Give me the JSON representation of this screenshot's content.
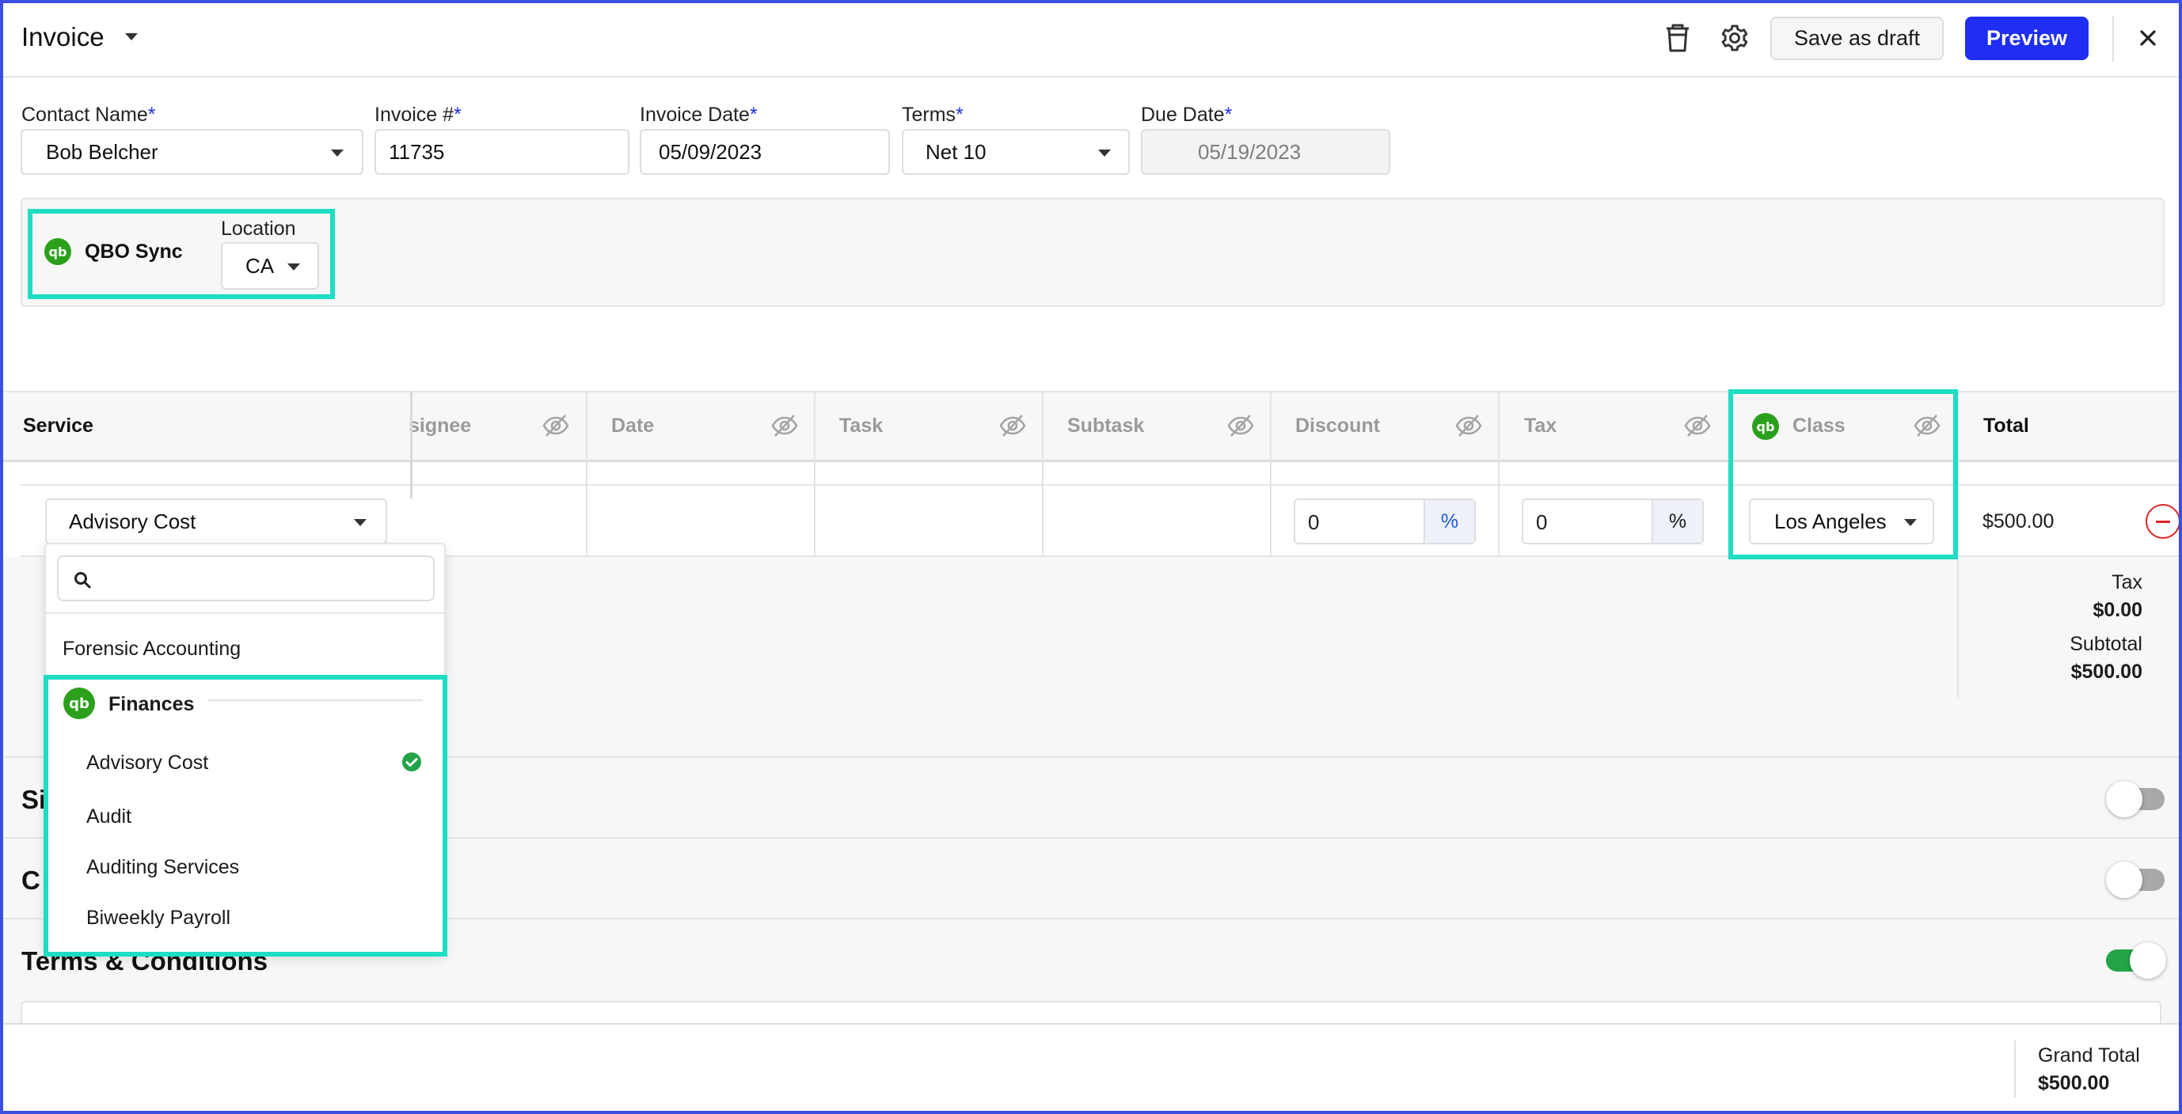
{
  "header": {
    "title": "Invoice",
    "save_draft_label": "Save as draft",
    "preview_label": "Preview"
  },
  "form": {
    "contact": {
      "label": "Contact Name",
      "required": "*",
      "value": "Bob Belcher"
    },
    "invoice_no": {
      "label": "Invoice #",
      "required": "*",
      "value": "11735"
    },
    "invoice_date": {
      "label": "Invoice Date",
      "required": "*",
      "value": "05/09/2023"
    },
    "terms": {
      "label": "Terms",
      "required": "*",
      "value": "Net 10"
    },
    "due_date": {
      "label": "Due Date",
      "required": "*",
      "value": "05/19/2023"
    }
  },
  "qbo": {
    "logo_text": "qb",
    "sync_label": "QBO Sync",
    "location_label": "Location",
    "location_value": "CA"
  },
  "table": {
    "columns": {
      "service": "Service",
      "assignee": "signee",
      "date": "Date",
      "task": "Task",
      "subtask": "Subtask",
      "discount": "Discount",
      "tax": "Tax",
      "class": "Class",
      "total": "Total"
    },
    "row": {
      "service": "Advisory Cost",
      "discount_value": "0",
      "discount_unit": "%",
      "tax_value": "0",
      "tax_unit": "%",
      "class": "Los Angeles",
      "total": "$500.00"
    }
  },
  "summary": {
    "tax_label": "Tax",
    "tax_value": "$0.00",
    "subtotal_label": "Subtotal",
    "subtotal_value": "$500.00"
  },
  "sections": {
    "s1": "Si",
    "s2": "C",
    "terms": "Terms & Conditions"
  },
  "toggles": {
    "s1": false,
    "s2": false,
    "terms": true
  },
  "footer": {
    "grand_total_label": "Grand Total",
    "grand_total_value": "$500.00"
  },
  "dropdown": {
    "search_placeholder": "",
    "items": [
      "Forensic Accounting"
    ],
    "group": {
      "name": "Finances",
      "items": [
        "Advisory Cost",
        "Audit",
        "Auditing Services",
        "Biweekly Payroll"
      ],
      "selected": "Advisory Cost"
    }
  },
  "colors": {
    "accent": "#1f2ef2",
    "highlight": "#1fdcc4",
    "qbo_green": "#2ca01c",
    "toggle_on": "#22a447"
  }
}
